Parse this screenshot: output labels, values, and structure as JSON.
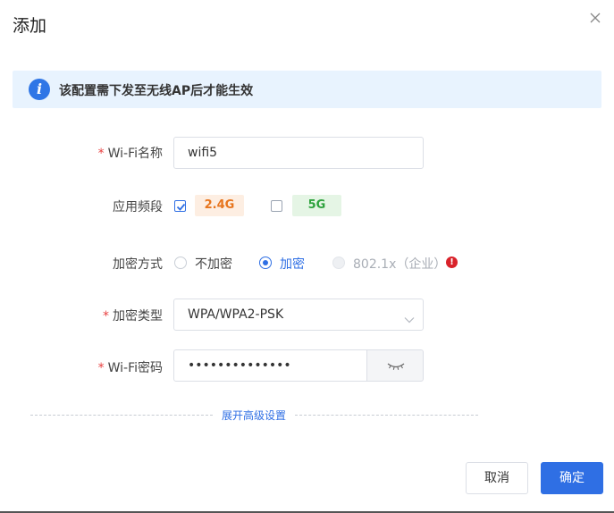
{
  "dialog": {
    "title": "添加",
    "close_icon": "close-icon"
  },
  "notice": {
    "icon": "info-icon",
    "text": "该配置需下发至无线AP后才能生效"
  },
  "form": {
    "ssid": {
      "required_mark": "*",
      "label": "Wi-Fi名称",
      "value": "wifi5"
    },
    "band": {
      "label": "应用频段",
      "options": [
        {
          "label": "2.4G",
          "checked": true,
          "color": "#e7751d"
        },
        {
          "label": "5G",
          "checked": false,
          "color": "#2ea23d"
        }
      ]
    },
    "encryption_mode": {
      "label": "加密方式",
      "options": [
        {
          "label": "不加密",
          "selected": false,
          "disabled": false
        },
        {
          "label": "加密",
          "selected": true,
          "disabled": false
        },
        {
          "label": "802.1x（企业）",
          "selected": false,
          "disabled": true
        }
      ],
      "warning_icon": "exclamation-icon",
      "warning_mark": "!"
    },
    "encryption_type": {
      "required_mark": "*",
      "label": "加密类型",
      "value": "WPA/WPA2-PSK"
    },
    "password": {
      "required_mark": "*",
      "label": "Wi-Fi密码",
      "value": "••••••••••••••"
    }
  },
  "advanced": {
    "link_text": "展开高级设置"
  },
  "footer": {
    "cancel_label": "取消",
    "ok_label": "确定"
  },
  "colors": {
    "accent": "#2f6fe4",
    "required": "#e84141",
    "notice_bg": "#e8f3fe"
  }
}
